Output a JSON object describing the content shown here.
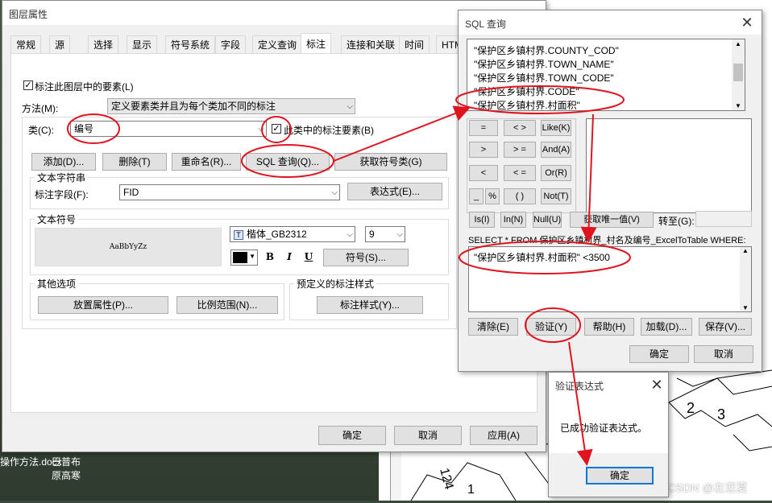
{
  "background": {
    "taskbar_items": [
      "操作方法.docx",
      "巴普布",
      "原高寒"
    ],
    "watermark": "CSDN @左恋夏",
    "map_labels": [
      "2",
      "3",
      "124",
      "1"
    ]
  },
  "layer_dialog": {
    "title": "图层属性",
    "tabs": [
      "常规",
      "源",
      "选择",
      "显示",
      "符号系统",
      "字段",
      "定义查询",
      "标注",
      "连接和关联",
      "时间",
      "HTM"
    ],
    "active_tab": "标注",
    "label_features_checkbox": "标注此图层中的要素(L)",
    "label_features_checked": true,
    "method_label": "方法(M):",
    "method_value": "定义要素类并且为每个类加不同的标注",
    "class_label": "类(C):",
    "class_value": "编号",
    "class_label_features": "此类中的标注要素(B)",
    "class_label_features_checked": true,
    "buttons": {
      "add": "添加(D)...",
      "delete": "删除(T)",
      "rename": "重命名(R)...",
      "sql_query": "SQL 查询(Q)...",
      "get_symbol_classes": "获取符号类(G)"
    },
    "text_string_group": "文本字符串",
    "label_field_label": "标注字段(F):",
    "label_field_value": "FID",
    "expression_button": "表达式(E)...",
    "text_symbol_group": "文本符号",
    "symbol_preview": "AaBbYyZz",
    "font_value": "楷体_GB2312",
    "font_size": "9",
    "bold": "B",
    "italic": "I",
    "underline": "U",
    "symbol_button": "符号(S)...",
    "other_options_group": "其他选项",
    "placement_button": "放置属性(P)...",
    "scale_range_button": "比例范围(N)...",
    "predefined_style_group": "预定义的标注样式",
    "label_styles_button": "标注样式(Y)...",
    "ok": "确定",
    "cancel": "取消",
    "apply": "应用(A)"
  },
  "sql_dialog": {
    "title": "SQL 查询",
    "fields": [
      "\"保护区乡镇村界.COUNTY_COD\"",
      "\"保护区乡镇村界.TOWN_NAME\"",
      "\"保护区乡镇村界.TOWN_CODE\"",
      "\"保护区乡镇村界.CODE\"",
      "\"保护区乡镇村界.村面积\""
    ],
    "operators": {
      "eq": "=",
      "ne": "< >",
      "like": "Like(K)",
      "gt": ">",
      "ge": "> =",
      "and": "And(A)",
      "lt": "<",
      "le": "< =",
      "or": "Or(R)",
      "underscore": "_",
      "percent": "%",
      "parens": "( )",
      "not": "Not(T)",
      "is": "Is(I)",
      "in": "In(N)",
      "null": "Null(U)"
    },
    "get_unique_values": "获取唯一值(V)",
    "goto_label": "转至(G):",
    "select_clause": "SELECT * FROM 保护区乡镇村界_村名及编号_ExcelToTable WHERE:",
    "where_expression": "\"保护区乡镇村界.村面积\" <3500",
    "clear": "清除(E)",
    "verify": "验证(Y)",
    "help": "帮助(H)",
    "load": "加载(D)...",
    "save": "保存(V)...",
    "ok": "确定",
    "cancel": "取消"
  },
  "verify_dialog": {
    "title": "验证表达式",
    "message": "已成功验证表达式。",
    "ok": "确定"
  },
  "colors": {
    "annotation_red": "#e0141e",
    "focus_blue": "#0078d7",
    "dialog_bg": "#f0f0f0"
  }
}
